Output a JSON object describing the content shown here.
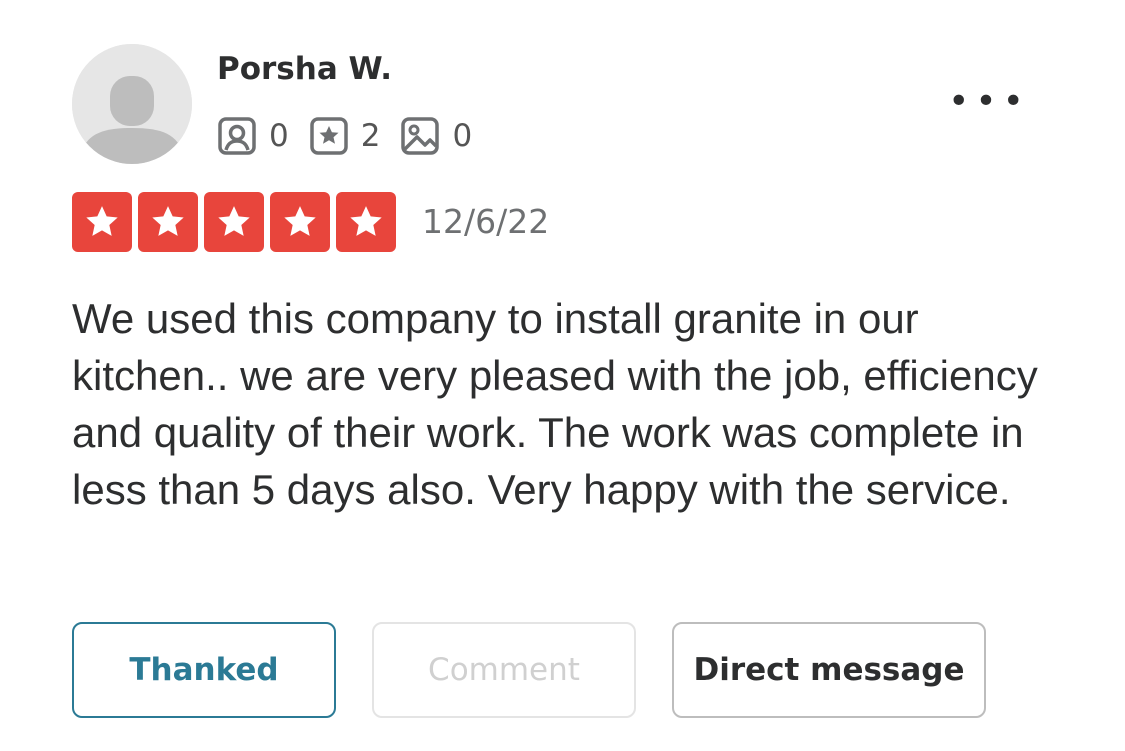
{
  "reviewer": {
    "name": "Porsha W.",
    "avatar_icon": "default-user-avatar",
    "stats": [
      {
        "icon": "friends-icon",
        "value": "0"
      },
      {
        "icon": "review-star-icon",
        "value": "2"
      },
      {
        "icon": "photo-icon",
        "value": "0"
      }
    ]
  },
  "menu": {
    "more_label": "•••"
  },
  "rating": {
    "stars": 5,
    "max": 5,
    "color": "#e8453c",
    "date": "12/6/22"
  },
  "review": {
    "text": "We used this company to install granite in our kitchen.. we are very pleased with the job, efficiency and quality of their work. The work was complete in less than 5 days also. Very happy with the service."
  },
  "actions": {
    "thanked": "Thanked",
    "comment": "Comment",
    "direct_message": "Direct message"
  },
  "colors": {
    "accent": "#2b7a95",
    "star_bg": "#e8453c",
    "text": "#2d2e2f",
    "muted": "#6e7072"
  }
}
